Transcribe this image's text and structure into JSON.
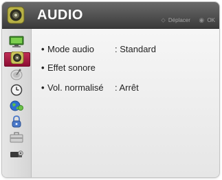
{
  "header": {
    "title": "AUDIO",
    "icon": "audio-speaker-icon",
    "hints": {
      "move_symbol": "⬦",
      "move_label": "Déplacer",
      "ok_symbol": "◉",
      "ok_label": "OK"
    }
  },
  "sidebar": {
    "items": [
      {
        "icon": "picture-monitor-icon",
        "active": false
      },
      {
        "icon": "audio-speaker-icon",
        "active": true
      },
      {
        "icon": "channel-satellite-icon",
        "active": false
      },
      {
        "icon": "time-clock-icon",
        "active": false
      },
      {
        "icon": "network-globe-icon",
        "active": false
      },
      {
        "icon": "lock-icon",
        "active": false
      },
      {
        "icon": "options-toolbox-icon",
        "active": false
      },
      {
        "icon": "input-camera-icon",
        "active": false
      }
    ]
  },
  "menu": {
    "bullet": "•",
    "items": [
      {
        "label": "Mode audio",
        "value": ": Standard"
      },
      {
        "label": "Effet sonore",
        "value": ""
      },
      {
        "label": "Vol. normalisé",
        "value": ": Arrêt"
      }
    ]
  },
  "colors": {
    "header_bg": "#4a4a4a",
    "active_item": "#a6183f",
    "text": "#222222"
  }
}
